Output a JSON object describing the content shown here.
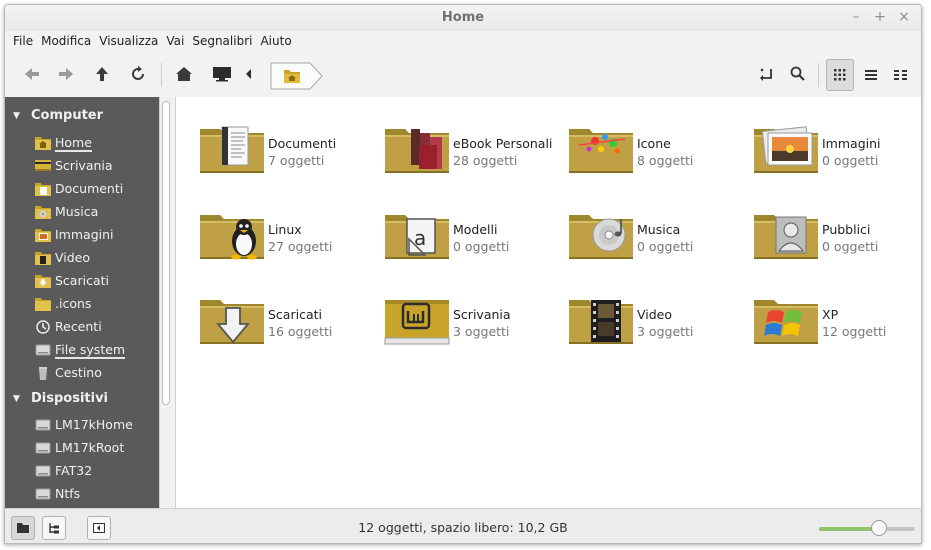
{
  "window": {
    "title": "Home",
    "controls": [
      "–",
      "+",
      "×"
    ]
  },
  "menubar": {
    "items": [
      "File",
      "Modifica",
      "Visualizza",
      "Vai",
      "Segnalibri",
      "Aiuto"
    ]
  },
  "toolbar": {
    "back_icon": "arrow-left-icon",
    "forward_icon": "arrow-right-icon",
    "up_icon": "arrow-up-icon",
    "reload_icon": "reload-icon",
    "home_icon": "home-icon",
    "computer_icon": "computer-icon",
    "crumb_prev_icon": "chevron-left-icon",
    "location_icon": "folder-home-icon",
    "open_terminal_icon": "open-location-icon",
    "search_icon": "search-icon",
    "view_icons": [
      "grid-view-icon",
      "list-view-icon",
      "compact-view-icon"
    ]
  },
  "sidebar": {
    "sections": [
      {
        "label": "Computer",
        "items": [
          {
            "label": "Home",
            "icon": "folder-home-icon",
            "underlined": true
          },
          {
            "label": "Scrivania",
            "icon": "desktop-icon"
          },
          {
            "label": "Documenti",
            "icon": "folder-documents-icon"
          },
          {
            "label": "Musica",
            "icon": "folder-music-icon"
          },
          {
            "label": "Immagini",
            "icon": "folder-pictures-icon"
          },
          {
            "label": "Video",
            "icon": "folder-video-icon"
          },
          {
            "label": "Scaricati",
            "icon": "folder-download-icon"
          },
          {
            "label": ".icons",
            "icon": "folder-icon"
          },
          {
            "label": "Recenti",
            "icon": "clock-icon"
          },
          {
            "label": "File system",
            "icon": "drive-icon",
            "underlined": true
          },
          {
            "label": "Cestino",
            "icon": "trash-icon"
          }
        ]
      },
      {
        "label": "Dispositivi",
        "items": [
          {
            "label": "LM17kHome",
            "icon": "drive-icon"
          },
          {
            "label": "LM17kRoot",
            "icon": "drive-icon"
          },
          {
            "label": "FAT32",
            "icon": "drive-icon"
          },
          {
            "label": "Ntfs",
            "icon": "drive-icon"
          }
        ]
      }
    ]
  },
  "files": [
    {
      "name": "Documenti",
      "count": "7 oggetti",
      "emblem": "document-emblem-icon"
    },
    {
      "name": "eBook Personali",
      "count": "28 oggetti",
      "emblem": "books-emblem-icon"
    },
    {
      "name": "Icone",
      "count": "8 oggetti",
      "emblem": "paint-splash-emblem-icon"
    },
    {
      "name": "Immagini",
      "count": "0 oggetti",
      "emblem": "photos-emblem-icon"
    },
    {
      "name": "Linux",
      "count": "27 oggetti",
      "emblem": "tux-emblem-icon"
    },
    {
      "name": "Modelli",
      "count": "0 oggetti",
      "emblem": "template-emblem-icon"
    },
    {
      "name": "Musica",
      "count": "0 oggetti",
      "emblem": "cd-emblem-icon"
    },
    {
      "name": "Pubblici",
      "count": "0 oggetti",
      "emblem": "person-emblem-icon"
    },
    {
      "name": "Scaricati",
      "count": "16 oggetti",
      "emblem": "download-arrow-emblem-icon"
    },
    {
      "name": "Scrivania",
      "count": "3 oggetti",
      "emblem": "mint-logo-emblem-icon"
    },
    {
      "name": "Video",
      "count": "3 oggetti",
      "emblem": "film-emblem-icon"
    },
    {
      "name": "XP",
      "count": "12 oggetti",
      "emblem": "windows-flag-emblem-icon"
    }
  ],
  "statusbar": {
    "text": "12 oggetti, spazio libero: 10,2 GB",
    "zoom_fraction": 0.63
  },
  "colors": {
    "folder": "#b49a3a",
    "folder_dark": "#8f7a2a",
    "sidebar_bg": "#5a5a5a",
    "zoom_accent": "#8fc36a"
  }
}
